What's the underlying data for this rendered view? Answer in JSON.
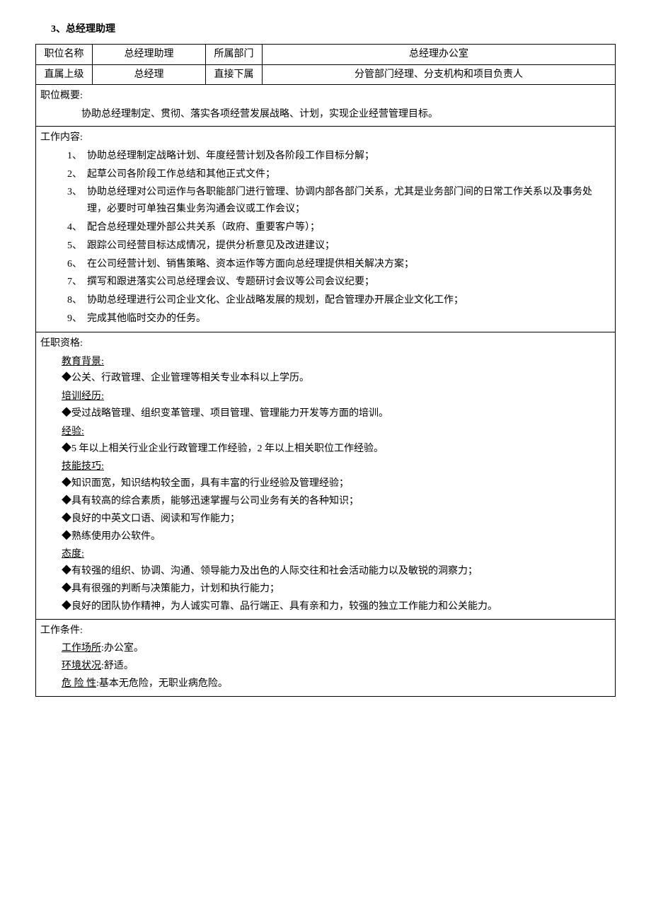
{
  "title": "3、总经理助理",
  "header": {
    "row1": {
      "label1": "职位名称",
      "value1": "总经理助理",
      "label2": "所属部门",
      "value2": "总经理办公室"
    },
    "row2": {
      "label1": "直属上级",
      "value1": "总经理",
      "label2": "直接下属",
      "value2": "分管部门经理、分支机构和项目负责人"
    }
  },
  "overview": {
    "label": "职位概要:",
    "text": "协助总经理制定、贯彻、落实各项经营发展战略、计划，实现企业经营管理目标。"
  },
  "work": {
    "label": "工作内容:",
    "items": [
      "协助总经理制定战略计划、年度经营计划及各阶段工作目标分解；",
      "起草公司各阶段工作总结和其他正式文件；",
      "协助总经理对公司运作与各职能部门进行管理、协调内部各部门关系，尤其是业务部门间的日常工作关系以及事务处理，必要时可单独召集业务沟通会议或工作会议；",
      "配合总经理处理外部公共关系（政府、重要客户等）；",
      "跟踪公司经营目标达成情况，提供分析意见及改进建议；",
      "在公司经营计划、销售策略、资本运作等方面向总经理提供相关解决方案；",
      "撰写和跟进落实公司总经理会议、专题研讨会议等公司会议纪要；",
      "协助总经理进行公司企业文化、企业战略发展的规划，配合管理办开展企业文化工作；",
      "完成其他临时交办的任务。"
    ]
  },
  "qualification": {
    "label": "任职资格:",
    "education": {
      "heading": "教育背景:",
      "items": [
        "◆公关、行政管理、企业管理等相关专业本科以上学历。"
      ]
    },
    "training": {
      "heading": "培训经历:",
      "items": [
        "◆受过战略管理、组织变革管理、项目管理、管理能力开发等方面的培训。"
      ]
    },
    "experience": {
      "heading": "经验:",
      "items": [
        "◆5 年以上相关行业企业行政管理工作经验，2 年以上相关职位工作经验。"
      ]
    },
    "skills": {
      "heading": "技能技巧:",
      "items": [
        "◆知识面宽，知识结构较全面，具有丰富的行业经验及管理经验；",
        "◆具有较高的综合素质，能够迅速掌握与公司业务有关的各种知识；",
        "◆良好的中英文口语、阅读和写作能力；",
        "◆熟练使用办公软件。"
      ]
    },
    "attitude": {
      "heading": "态度:",
      "items": [
        "◆有较强的组织、协调、沟通、领导能力及出色的人际交往和社会活动能力以及敏锐的洞察力；",
        "◆具有很强的判断与决策能力，计划和执行能力；",
        "◆良好的团队协作精神，为人诚实可靠、品行端正、具有亲和力，较强的独立工作能力和公关能力。"
      ]
    }
  },
  "conditions": {
    "label": "工作条件:",
    "items": [
      {
        "k": "工作场所",
        "v": ":办公室。"
      },
      {
        "k": "环境状况",
        "v": ":舒适。"
      },
      {
        "k": "危 险 性",
        "v": ":基本无危险，无职业病危险。"
      }
    ]
  }
}
